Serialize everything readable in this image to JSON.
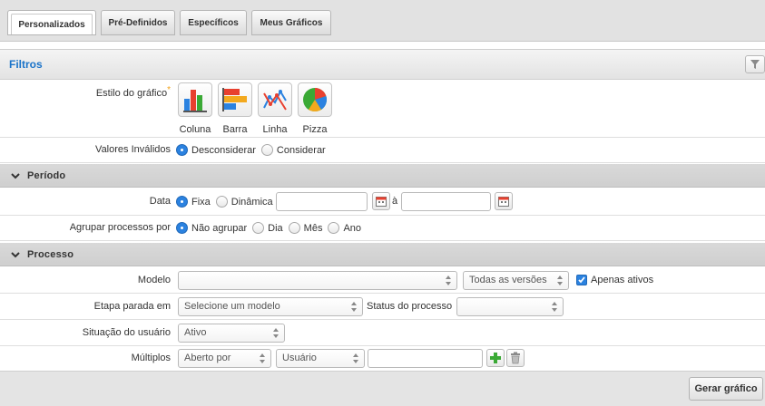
{
  "tabs": [
    {
      "label": "Personalizados",
      "active": true
    },
    {
      "label": "Pré-Definidos",
      "active": false
    },
    {
      "label": "Específicos",
      "active": false
    },
    {
      "label": "Meus Gráficos",
      "active": false
    }
  ],
  "filters": {
    "title": "Filtros",
    "chart_style": {
      "label": "Estilo do gráfico",
      "required_mark": "*",
      "options": [
        {
          "label": "Coluna",
          "icon": "column-chart-icon"
        },
        {
          "label": "Barra",
          "icon": "bar-chart-icon"
        },
        {
          "label": "Linha",
          "icon": "line-chart-icon"
        },
        {
          "label": "Pizza",
          "icon": "pie-chart-icon"
        }
      ]
    },
    "invalid_values": {
      "label": "Valores Inválidos",
      "options": [
        {
          "label": "Desconsiderar",
          "checked": true
        },
        {
          "label": "Considerar",
          "checked": false
        }
      ]
    }
  },
  "period": {
    "title": "Período",
    "date": {
      "label": "Data",
      "options": [
        {
          "label": "Fixa",
          "checked": true
        },
        {
          "label": "Dinâmica",
          "checked": false
        }
      ],
      "from_value": "",
      "to_separator": "à",
      "to_value": ""
    },
    "group_by": {
      "label": "Agrupar processos por",
      "options": [
        {
          "label": "Não agrupar",
          "checked": true
        },
        {
          "label": "Dia",
          "checked": false
        },
        {
          "label": "Mês",
          "checked": false
        },
        {
          "label": "Ano",
          "checked": false
        }
      ]
    }
  },
  "process": {
    "title": "Processo",
    "model": {
      "label": "Modelo",
      "value": "",
      "versions_value": "Todas as versões",
      "only_active_label": "Apenas ativos",
      "only_active_checked": true
    },
    "stopped_stage": {
      "label": "Etapa parada em",
      "value": "Selecione um modelo",
      "status_label": "Status do processo",
      "status_value": ""
    },
    "user_situation": {
      "label": "Situação do usuário",
      "value": "Ativo"
    },
    "multiples": {
      "label": "Múltiplos",
      "field_value": "Aberto por",
      "entity_value": "Usuário",
      "text_value": ""
    }
  },
  "footer": {
    "submit_label": "Gerar gráfico"
  },
  "colors": {
    "accent": "#2b82e0",
    "title_blue": "#1a73c9",
    "add_green": "#3aa935"
  }
}
